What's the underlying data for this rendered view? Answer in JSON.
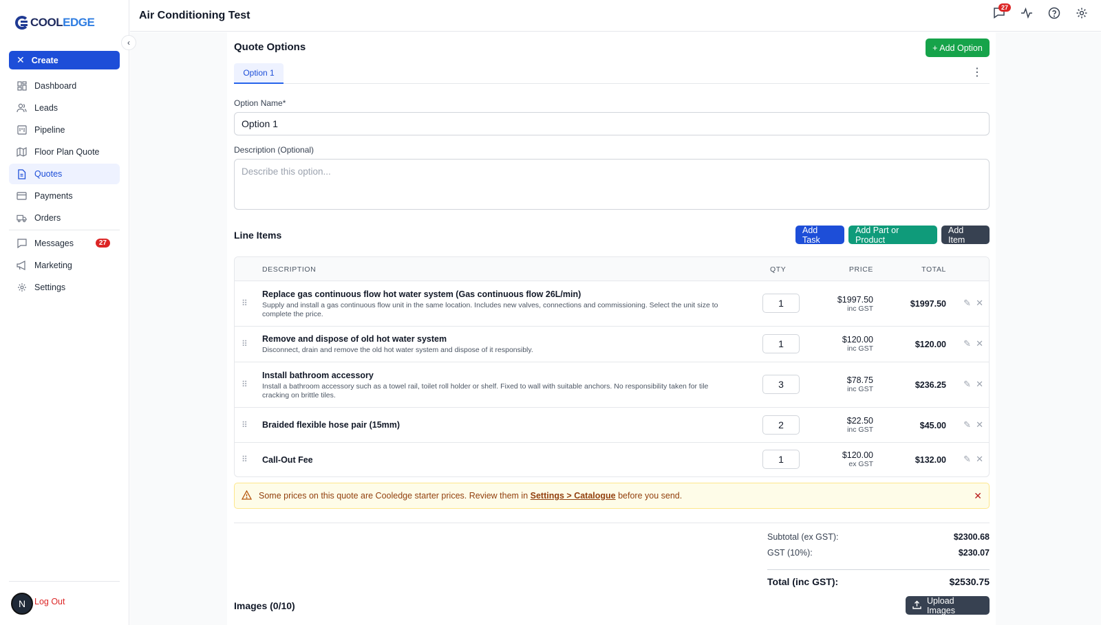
{
  "app": {
    "logo_part1": "COOL",
    "logo_part2": "EDGE",
    "page_title": "Air Conditioning Test",
    "notifications_count": "27"
  },
  "sidebar": {
    "create_label": "Create",
    "items": [
      {
        "label": "Dashboard",
        "icon": "dashboard-icon"
      },
      {
        "label": "Leads",
        "icon": "users-icon"
      },
      {
        "label": "Pipeline",
        "icon": "kanban-icon"
      },
      {
        "label": "Floor Plan Quote",
        "icon": "map-icon"
      },
      {
        "label": "Quotes",
        "icon": "document-icon"
      },
      {
        "label": "Payments",
        "icon": "credit-card-icon"
      },
      {
        "label": "Orders",
        "icon": "truck-icon"
      },
      {
        "label": "Messages",
        "icon": "chat-icon",
        "badge": "27"
      },
      {
        "label": "Marketing",
        "icon": "megaphone-icon"
      },
      {
        "label": "Settings",
        "icon": "gear-icon"
      }
    ],
    "avatar_letter": "N",
    "logout_label": "Log Out"
  },
  "quote_options": {
    "title": "Quote Options",
    "add_option_label": "+ Add Option",
    "tabs": [
      {
        "label": "Option 1"
      }
    ],
    "option_name_label": "Option Name",
    "required_mark": "*",
    "option_name_value": "Option 1",
    "description_label": "Description (Optional)",
    "description_placeholder": "Describe this option..."
  },
  "line_items": {
    "title": "Line Items",
    "add_task_label": "Add Task",
    "add_part_label": "Add Part or Product",
    "add_item_label": "Add Item",
    "columns": {
      "description": "DESCRIPTION",
      "qty": "QTY",
      "price": "PRICE",
      "total": "TOTAL"
    },
    "rows": [
      {
        "title": "Replace gas continuous flow hot water system (Gas continuous flow 26L/min)",
        "subtitle": "Supply and install a gas continuous flow unit in the same location. Includes new valves, connections and commissioning. Select the unit size to complete the price.",
        "qty": "1",
        "price": "$1997.50",
        "gst": "inc GST",
        "total": "$1997.50"
      },
      {
        "title": "Remove and dispose of old hot water system",
        "subtitle": "Disconnect, drain and remove the old hot water system and dispose of it responsibly.",
        "qty": "1",
        "price": "$120.00",
        "gst": "inc GST",
        "total": "$120.00"
      },
      {
        "title": "Install bathroom accessory",
        "subtitle": "Install a bathroom accessory such as a towel rail, toilet roll holder or shelf. Fixed to wall with suitable anchors. No responsibility taken for tile cracking on brittle tiles.",
        "qty": "3",
        "price": "$78.75",
        "gst": "inc GST",
        "total": "$236.25"
      },
      {
        "title": "Braided flexible hose pair (15mm)",
        "subtitle": "",
        "qty": "2",
        "price": "$22.50",
        "gst": "inc GST",
        "total": "$45.00"
      },
      {
        "title": "Call-Out Fee",
        "subtitle": "",
        "qty": "1",
        "price": "$120.00",
        "gst": "ex GST",
        "total": "$132.00"
      }
    ]
  },
  "warning": {
    "text_before": "Some prices on this quote are Cooledge starter prices. Review them in ",
    "link": "Settings > Catalogue",
    "text_after": " before you send."
  },
  "totals": {
    "subtotal_label": "Subtotal (ex GST):",
    "subtotal_value": "$2300.68",
    "gst_label": "GST (10%):",
    "gst_value": "$230.07",
    "total_label": "Total (inc GST):",
    "total_value": "$2530.75"
  },
  "images": {
    "title": "Images (0/10)",
    "upload_label": "Upload Images"
  },
  "colors": {
    "primary": "#1d4ed8",
    "green": "#16a34a",
    "teal": "#0f9b7a",
    "dark": "#374151",
    "badge": "#dc2626"
  }
}
